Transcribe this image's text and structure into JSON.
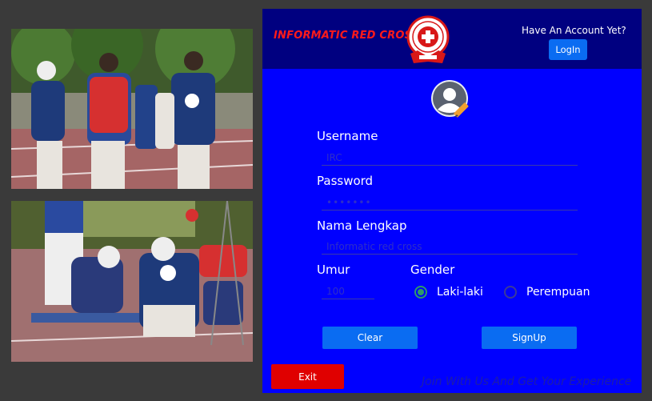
{
  "header": {
    "brand": "INFORMATIC RED CROSS",
    "have_account": "Have An Account Yet?",
    "login_label": "LogIn"
  },
  "form": {
    "username_label": "Username",
    "username_value": "IRC",
    "password_label": "Password",
    "password_value": "•••••••",
    "fullname_label": "Nama Lengkap",
    "fullname_value": "Informatic red cross",
    "age_label": "Umur",
    "age_value": "100",
    "gender_label": "Gender",
    "gender_options": [
      {
        "label": "Laki-laki",
        "selected": true
      },
      {
        "label": "Perempuan",
        "selected": false
      }
    ]
  },
  "buttons": {
    "clear_label": "Clear",
    "signup_label": "SignUp",
    "exit_label": "Exit"
  },
  "tagline": "Join With Us And Get Your Experience",
  "colors": {
    "panel": "#0000ff",
    "header": "#000080",
    "accent_button": "#0a6cf2",
    "exit_button": "#e00000",
    "brand_text": "#ff1a1a"
  }
}
